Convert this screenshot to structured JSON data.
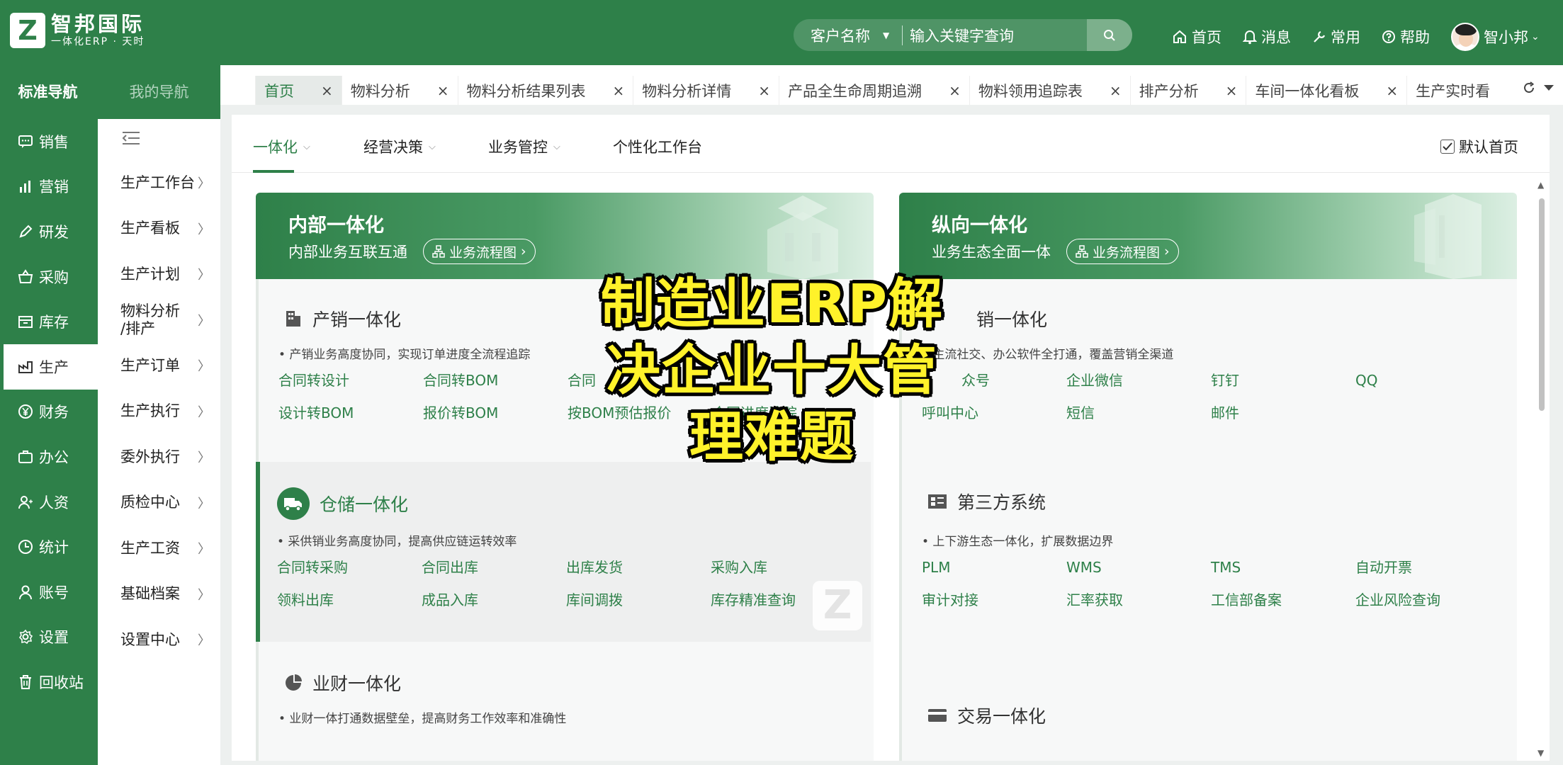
{
  "brand": {
    "logo_letter": "Z",
    "name": "智邦国际",
    "tagline": "一体化ERP · 天时"
  },
  "search": {
    "type_label": "客户名称",
    "placeholder": "输入关键字查询"
  },
  "topnav": {
    "home": "首页",
    "messages": "消息",
    "common": "常用",
    "help": "帮助",
    "user": "智小邦"
  },
  "sidebar1": {
    "title": "标准导航",
    "items": [
      "销售",
      "营销",
      "研发",
      "采购",
      "库存",
      "生产",
      "财务",
      "办公",
      "人资",
      "统计",
      "账号",
      "设置",
      "回收站"
    ],
    "active_index": 5
  },
  "sidebar2": {
    "title": "我的导航",
    "items": [
      "生产工作台",
      "生产看板",
      "生产计划",
      "物料分析\n/排产",
      "生产订单",
      "生产执行",
      "委外执行",
      "质检中心",
      "生产工资",
      "基础档案",
      "设置中心"
    ]
  },
  "tabs": [
    "首页",
    "物料分析",
    "物料分析结果列表",
    "物料分析详情",
    "产品全生命周期追溯",
    "物料领用追踪表",
    "排产分析",
    "车间一体化看板",
    "生产实时看"
  ],
  "tab_close": "×",
  "subnav": {
    "items": [
      "一体化",
      "经营决策",
      "业务管控",
      "个性化工作台"
    ],
    "default_home": "默认首页"
  },
  "panel_left": {
    "title": "内部一体化",
    "subtitle": "内部业务互联互通",
    "flow_button": "业务流程图",
    "sections": [
      {
        "title": "产销一体化",
        "desc": "• 产销业务高度协同，实现订单进度全流程追踪",
        "links": [
          "合同转设计",
          "合同转BOM",
          "合同",
          "",
          "设计转BOM",
          "报价转BOM",
          "按BOM预估报价",
          "合同进度追踪"
        ]
      },
      {
        "title": "仓储一体化",
        "desc": "• 采供销业务高度协同，提高供应链运转效率",
        "links": [
          "合同转采购",
          "合同出库",
          "出库发货",
          "采购入库",
          "领料出库",
          "成品入库",
          "库间调拨",
          "库存精准查询"
        ]
      },
      {
        "title": "业财一体化",
        "desc": "• 业财一体打通数据壁垒，提高财务工作效率和准确性",
        "links": []
      }
    ]
  },
  "panel_right": {
    "title": "纵向一体化",
    "subtitle": "业务生态全面一体",
    "flow_button": "业务流程图",
    "sections": [
      {
        "title": "销一体化",
        "desc": "• 主流社交、办公软件全打通，覆盖营销全渠道",
        "links": [
          "众号",
          "企业微信",
          "钉钉",
          "QQ",
          "呼叫中心",
          "短信",
          "邮件",
          ""
        ]
      },
      {
        "title": "第三方系统",
        "desc": "• 上下游生态一体化，扩展数据边界",
        "links": [
          "PLM",
          "WMS",
          "TMS",
          "自动开票",
          "审计对接",
          "汇率获取",
          "工信部备案",
          "企业风险查询"
        ]
      },
      {
        "title": "交易一体化",
        "desc": "",
        "links": []
      }
    ]
  },
  "overlay_text": [
    "制造业ERP解",
    "决企业十大管",
    "理难题"
  ],
  "colors": {
    "brand_green": "#2e8049",
    "link_green": "#2e8049",
    "overlay_yellow": "#fff22a"
  }
}
